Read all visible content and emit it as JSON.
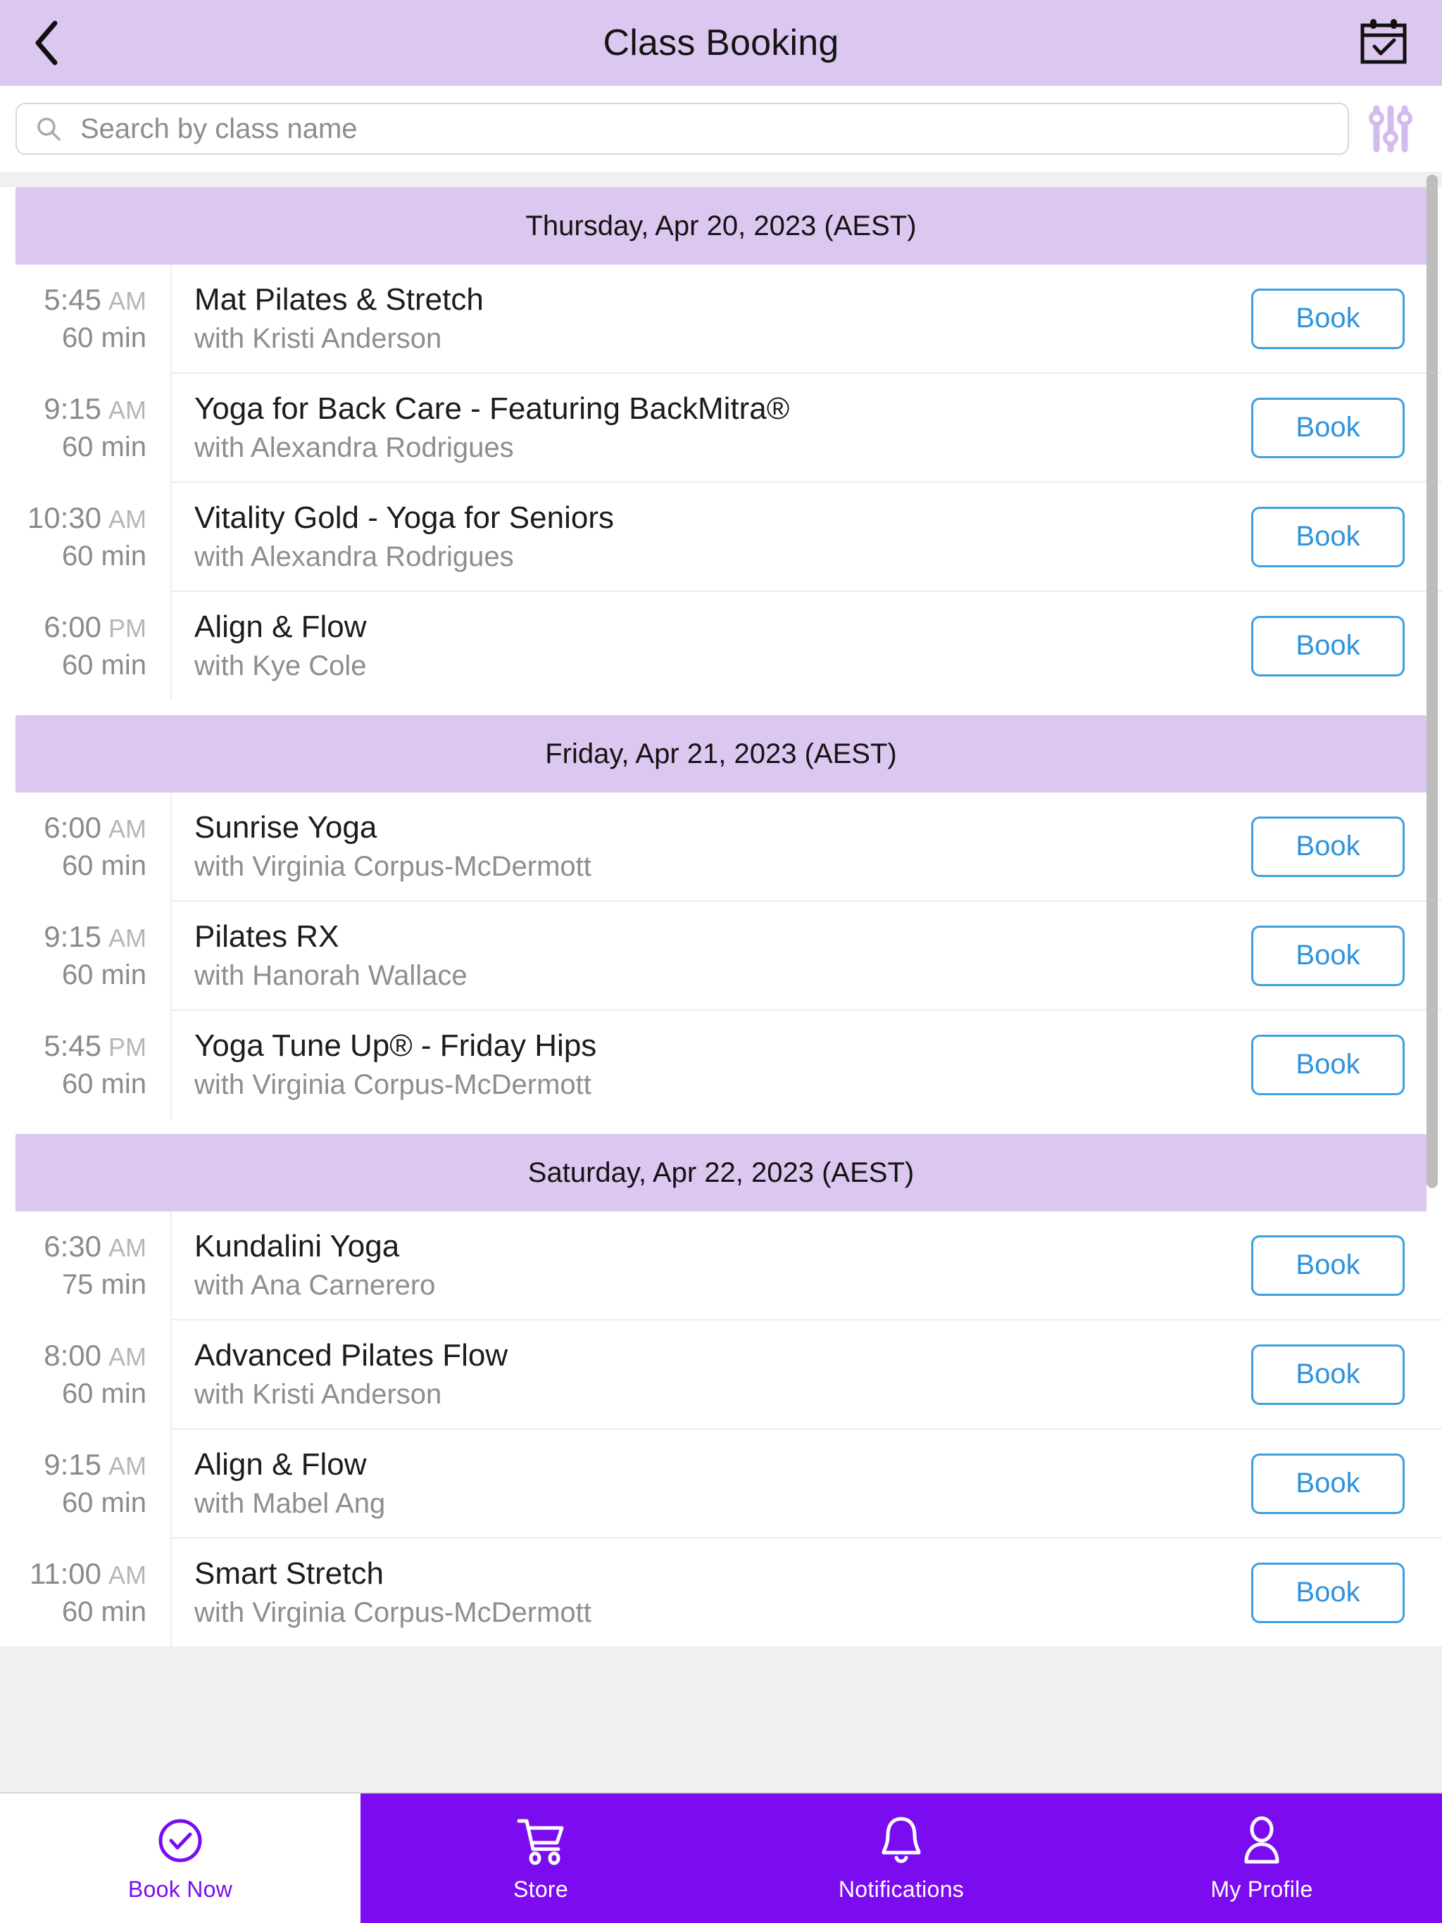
{
  "header": {
    "title": "Class Booking",
    "back_icon": "chevron-left-icon",
    "calendar_icon": "calendar-check-icon"
  },
  "search": {
    "placeholder": "Search by class name",
    "value": "",
    "search_icon": "search-icon",
    "filter_icon": "filter-sliders-icon"
  },
  "colors": {
    "header_bg": "#dcc7f0",
    "day_header_bg": "#dcc7f0",
    "accent_purple": "#7b0cf0",
    "book_border": "#3d9fe0",
    "book_text": "#2f93dd",
    "page_bg": "#f0f0f0"
  },
  "book_label": "Book",
  "sections": [
    {
      "date_label": "Thursday, Apr 20, 2023 (AEST)",
      "classes": [
        {
          "time": "5:45",
          "meridiem": "AM",
          "duration": "60 min",
          "name": "Mat Pilates & Stretch",
          "instructor": "with Kristi Anderson",
          "action": "Book"
        },
        {
          "time": "9:15",
          "meridiem": "AM",
          "duration": "60 min",
          "name": "Yoga for Back Care - Featuring BackMitra®",
          "instructor": "with Alexandra Rodrigues",
          "action": "Book"
        },
        {
          "time": "10:30",
          "meridiem": "AM",
          "duration": "60 min",
          "name": "Vitality Gold - Yoga for Seniors",
          "instructor": "with Alexandra Rodrigues",
          "action": "Book"
        },
        {
          "time": "6:00",
          "meridiem": "PM",
          "duration": "60 min",
          "name": "Align & Flow",
          "instructor": "with Kye Cole",
          "action": "Book"
        }
      ]
    },
    {
      "date_label": "Friday, Apr 21, 2023 (AEST)",
      "classes": [
        {
          "time": "6:00",
          "meridiem": "AM",
          "duration": "60 min",
          "name": "Sunrise Yoga",
          "instructor": "with Virginia Corpus-McDermott",
          "action": "Book"
        },
        {
          "time": "9:15",
          "meridiem": "AM",
          "duration": "60 min",
          "name": "Pilates RX",
          "instructor": "with Hanorah Wallace",
          "action": "Book"
        },
        {
          "time": "5:45",
          "meridiem": "PM",
          "duration": "60 min",
          "name": "Yoga Tune Up® - Friday Hips",
          "instructor": "with Virginia Corpus-McDermott",
          "action": "Book"
        }
      ]
    },
    {
      "date_label": "Saturday, Apr 22, 2023 (AEST)",
      "classes": [
        {
          "time": "6:30",
          "meridiem": "AM",
          "duration": "75 min",
          "name": "Kundalini Yoga",
          "instructor": "with Ana Carnerero",
          "action": "Book"
        },
        {
          "time": "8:00",
          "meridiem": "AM",
          "duration": "60 min",
          "name": "Advanced Pilates Flow",
          "instructor": "with Kristi Anderson",
          "action": "Book"
        },
        {
          "time": "9:15",
          "meridiem": "AM",
          "duration": "60 min",
          "name": "Align & Flow",
          "instructor": "with Mabel Ang",
          "action": "Book"
        },
        {
          "time": "11:00",
          "meridiem": "AM",
          "duration": "60 min",
          "name": "Smart Stretch",
          "instructor": "with Virginia Corpus-McDermott",
          "action": "Book"
        }
      ]
    }
  ],
  "bottom_nav": [
    {
      "label": "Book Now",
      "icon": "check-circle-icon",
      "active": true
    },
    {
      "label": "Store",
      "icon": "shopping-cart-icon",
      "active": false
    },
    {
      "label": "Notifications",
      "icon": "bell-icon",
      "active": false
    },
    {
      "label": "My Profile",
      "icon": "user-icon",
      "active": false
    }
  ]
}
